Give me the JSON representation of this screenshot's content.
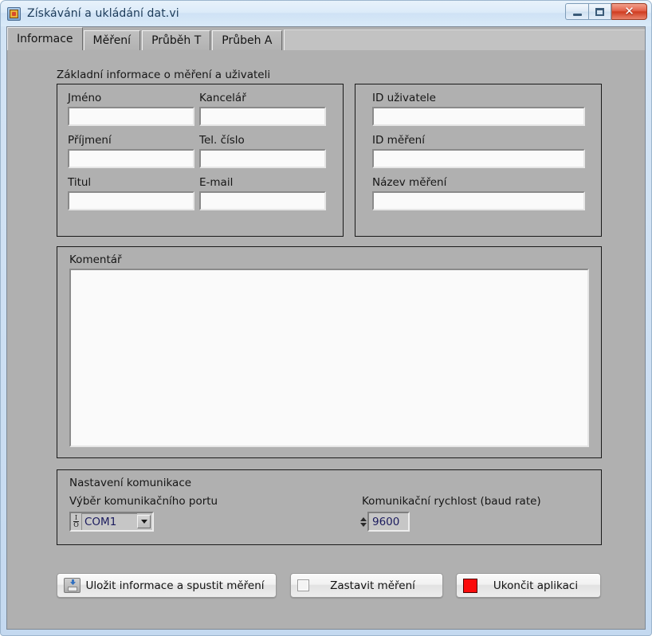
{
  "window": {
    "title": "Získávání a ukládání dat.vi",
    "icon": "labview-vi-icon",
    "buttons": {
      "minimize": "–",
      "maximize": "□",
      "close": "✕"
    }
  },
  "tabs": [
    {
      "label": "Informace",
      "active": true
    },
    {
      "label": "Měření",
      "active": false
    },
    {
      "label": "Průběh T",
      "active": false
    },
    {
      "label": "Průbeh A",
      "active": false
    }
  ],
  "info_page": {
    "caption": "Základní informace o měření a uživateli",
    "user_group": {
      "fields": [
        {
          "label": "Jméno",
          "value": "",
          "placeholder": ""
        },
        {
          "label": "Kancelář",
          "value": "",
          "placeholder": ""
        },
        {
          "label": "Příjmení",
          "value": "",
          "placeholder": ""
        },
        {
          "label": "Tel. číslo",
          "value": "",
          "placeholder": ""
        },
        {
          "label": "Titul",
          "value": "",
          "placeholder": ""
        },
        {
          "label": "E-mail",
          "value": "",
          "placeholder": ""
        }
      ]
    },
    "id_group": {
      "fields": [
        {
          "label": "ID uživatele",
          "value": "",
          "placeholder": ""
        },
        {
          "label": "ID měření",
          "value": "",
          "placeholder": ""
        },
        {
          "label": "Název měření",
          "value": "",
          "placeholder": ""
        }
      ]
    },
    "comment_group": {
      "label": "Komentář",
      "value": "",
      "placeholder": ""
    },
    "communication_group": {
      "caption": "Nastavení komunikace",
      "port": {
        "label": "Výběr komunikačního portu",
        "value": "COM1",
        "glyph_top": "I",
        "glyph_bottom": "O",
        "options": [
          "COM1"
        ]
      },
      "baud": {
        "label": "Komunikační rychlost (baud rate)",
        "value": "9600"
      }
    }
  },
  "actions": [
    {
      "label": "Uložit informace a spustit měření",
      "icon": "save-disk-icon"
    },
    {
      "label": "Zastavit měření",
      "icon": "white-square-icon"
    },
    {
      "label": "Ukončit aplikaci",
      "icon": "red-square-icon"
    }
  ],
  "colors": {
    "panel": "#b0b0b0",
    "field_fill": "#fafafa",
    "accent_red": "#fb0a0a",
    "title_text": "#1b3a58",
    "numeric_text": "#1b1b5e"
  }
}
